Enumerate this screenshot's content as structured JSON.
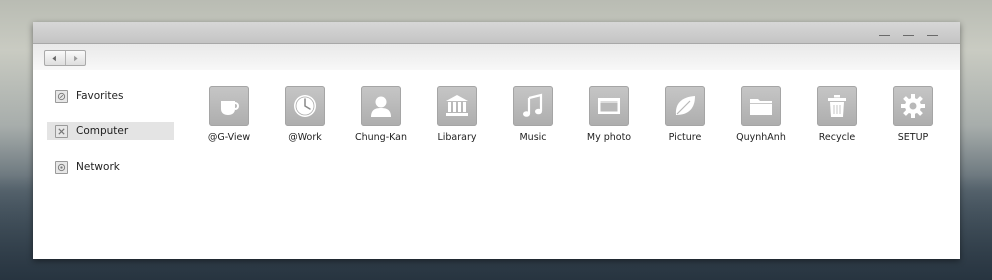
{
  "sidebar": {
    "items": [
      {
        "label": "Favorites",
        "icon": "favorites-icon",
        "selected": false
      },
      {
        "label": "Computer",
        "icon": "computer-icon",
        "selected": true
      },
      {
        "label": "Network",
        "icon": "network-icon",
        "selected": false
      }
    ]
  },
  "tiles": [
    {
      "label": "@G-View",
      "icon": "cup-icon"
    },
    {
      "label": "@Work",
      "icon": "clock-icon"
    },
    {
      "label": "Chung-Kan",
      "icon": "user-icon"
    },
    {
      "label": "Libarary",
      "icon": "library-icon"
    },
    {
      "label": "Music",
      "icon": "music-icon"
    },
    {
      "label": "My photo",
      "icon": "photo-frame-icon"
    },
    {
      "label": "Picture",
      "icon": "leaf-icon"
    },
    {
      "label": "QuynhAnh",
      "icon": "folder-icon"
    },
    {
      "label": "Recycle",
      "icon": "recycle-bin-icon"
    },
    {
      "label": "SETUP",
      "icon": "gear-icon"
    }
  ],
  "colors": {
    "tile_bg": "#b9b9b9",
    "selected_bg": "#e4e4e4",
    "titlebar": "#cdcdcd"
  }
}
